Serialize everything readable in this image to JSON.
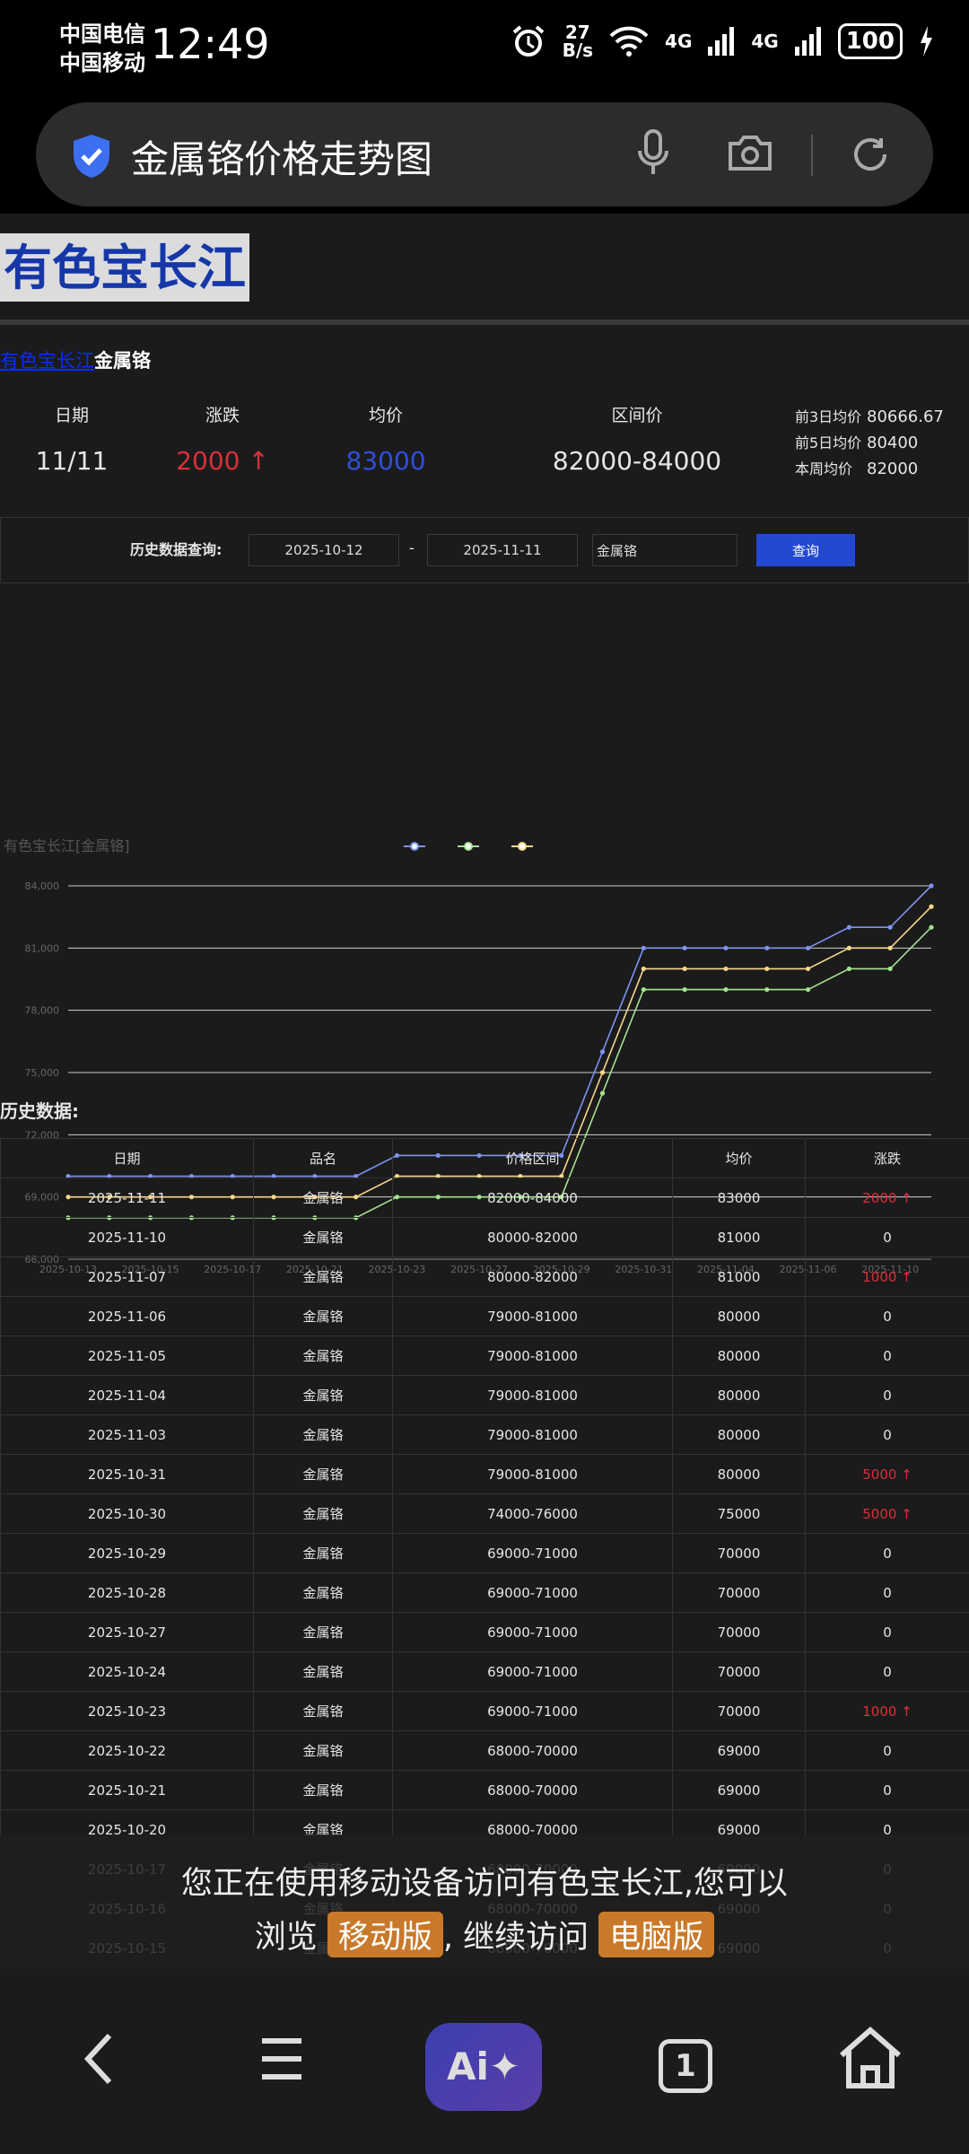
{
  "status_bar": {
    "carrier_1": "中国电信",
    "carrier_2": "中国移动",
    "time": "12:49",
    "speed_value": "27",
    "speed_unit": "B/s",
    "net_1": "4G",
    "net_2": "4G",
    "battery": "100"
  },
  "browser": {
    "query": "金属铬价格走势图"
  },
  "page": {
    "brand": "有色宝长江",
    "breadcrumb_link": "有色宝长江",
    "breadcrumb_current": "金属铬"
  },
  "summary": {
    "date_label": "日期",
    "date_value": "11/11",
    "change_label": "涨跌",
    "change_value": "2000 ↑",
    "avg_label": "均价",
    "avg_value": "83000",
    "range_label": "区间价",
    "range_value": "82000-84000",
    "stats": [
      {
        "label": "前3日均价",
        "value": "80666.67"
      },
      {
        "label": "前5日均价",
        "value": "80400"
      },
      {
        "label": "本周均价",
        "value": "82000"
      }
    ]
  },
  "query": {
    "label": "历史数据查询:",
    "start_date": "2025-10-12",
    "dash": "-",
    "end_date": "2025-11-11",
    "product": "金属铬",
    "button": "查询"
  },
  "chart_data": {
    "type": "line",
    "title": "有色宝长江[金属铬]",
    "x": [
      "2025-10-13",
      "2025-10-14",
      "2025-10-15",
      "2025-10-16",
      "2025-10-17",
      "2025-10-20",
      "2025-10-21",
      "2025-10-22",
      "2025-10-23",
      "2025-10-24",
      "2025-10-27",
      "2025-10-28",
      "2025-10-29",
      "2025-10-30",
      "2025-10-31",
      "2025-11-03",
      "2025-11-04",
      "2025-11-05",
      "2025-11-06",
      "2025-11-07",
      "2025-11-10",
      "2025-11-11"
    ],
    "x_tick_labels": [
      "2025-10-13",
      "2025-10-15",
      "2025-10-17",
      "2025-10-21",
      "2025-10-23",
      "2025-10-27",
      "2025-10-29",
      "2025-10-31",
      "2025-11-04",
      "2025-11-06",
      "2025-11-10"
    ],
    "series": [
      {
        "name": "",
        "color": "#7e93f0",
        "values": [
          70000,
          70000,
          70000,
          70000,
          70000,
          70000,
          70000,
          70000,
          71000,
          71000,
          71000,
          71000,
          71000,
          76000,
          81000,
          81000,
          81000,
          81000,
          81000,
          82000,
          82000,
          84000
        ]
      },
      {
        "name": "",
        "color": "#a6e38f",
        "values": [
          68000,
          68000,
          68000,
          68000,
          68000,
          68000,
          68000,
          68000,
          69000,
          69000,
          69000,
          69000,
          69000,
          74000,
          79000,
          79000,
          79000,
          79000,
          79000,
          80000,
          80000,
          82000
        ]
      },
      {
        "name": "",
        "color": "#f7d88a",
        "values": [
          69000,
          69000,
          69000,
          69000,
          69000,
          69000,
          69000,
          69000,
          70000,
          70000,
          70000,
          70000,
          70000,
          75000,
          80000,
          80000,
          80000,
          80000,
          80000,
          81000,
          81000,
          83000
        ]
      }
    ],
    "y_ticks": [
      "66,000",
      "69,000",
      "72,000",
      "75,000",
      "78,000",
      "81,000",
      "84,000"
    ],
    "ylim": [
      66000,
      84000
    ],
    "grid": true,
    "legend": "top-center"
  },
  "history": {
    "title": "历史数据:",
    "headers": [
      "日期",
      "品名",
      "价格区间",
      "均价",
      "涨跌"
    ],
    "rows": [
      [
        "2025-11-11",
        "金属铬",
        "82000-84000",
        "83000",
        "2000 ↑"
      ],
      [
        "2025-11-10",
        "金属铬",
        "80000-82000",
        "81000",
        "0"
      ],
      [
        "2025-11-07",
        "金属铬",
        "80000-82000",
        "81000",
        "1000 ↑"
      ],
      [
        "2025-11-06",
        "金属铬",
        "79000-81000",
        "80000",
        "0"
      ],
      [
        "2025-11-05",
        "金属铬",
        "79000-81000",
        "80000",
        "0"
      ],
      [
        "2025-11-04",
        "金属铬",
        "79000-81000",
        "80000",
        "0"
      ],
      [
        "2025-11-03",
        "金属铬",
        "79000-81000",
        "80000",
        "0"
      ],
      [
        "2025-10-31",
        "金属铬",
        "79000-81000",
        "80000",
        "5000 ↑"
      ],
      [
        "2025-10-30",
        "金属铬",
        "74000-76000",
        "75000",
        "5000 ↑"
      ],
      [
        "2025-10-29",
        "金属铬",
        "69000-71000",
        "70000",
        "0"
      ],
      [
        "2025-10-28",
        "金属铬",
        "69000-71000",
        "70000",
        "0"
      ],
      [
        "2025-10-27",
        "金属铬",
        "69000-71000",
        "70000",
        "0"
      ],
      [
        "2025-10-24",
        "金属铬",
        "69000-71000",
        "70000",
        "0"
      ],
      [
        "2025-10-23",
        "金属铬",
        "69000-71000",
        "70000",
        "1000 ↑"
      ],
      [
        "2025-10-22",
        "金属铬",
        "68000-70000",
        "69000",
        "0"
      ],
      [
        "2025-10-21",
        "金属铬",
        "68000-70000",
        "69000",
        "0"
      ],
      [
        "2025-10-20",
        "金属铬",
        "68000-70000",
        "69000",
        "0"
      ],
      [
        "2025-10-17",
        "金属铬",
        "68000-70000",
        "69000",
        "0"
      ],
      [
        "2025-10-16",
        "金属铬",
        "68000-70000",
        "69000",
        "0"
      ],
      [
        "2025-10-15",
        "金属铬",
        "68000-70000",
        "69000",
        "0"
      ]
    ]
  },
  "overlay": {
    "line1": "您正在使用移动设备访问有色宝长江,您可以",
    "prefix": "浏览",
    "mobile_btn": "移动版",
    "middle": ", 继续访问",
    "pc_btn": "电脑版"
  },
  "navbar": {
    "ai_label": "Ai✦",
    "tab_count": "1"
  }
}
